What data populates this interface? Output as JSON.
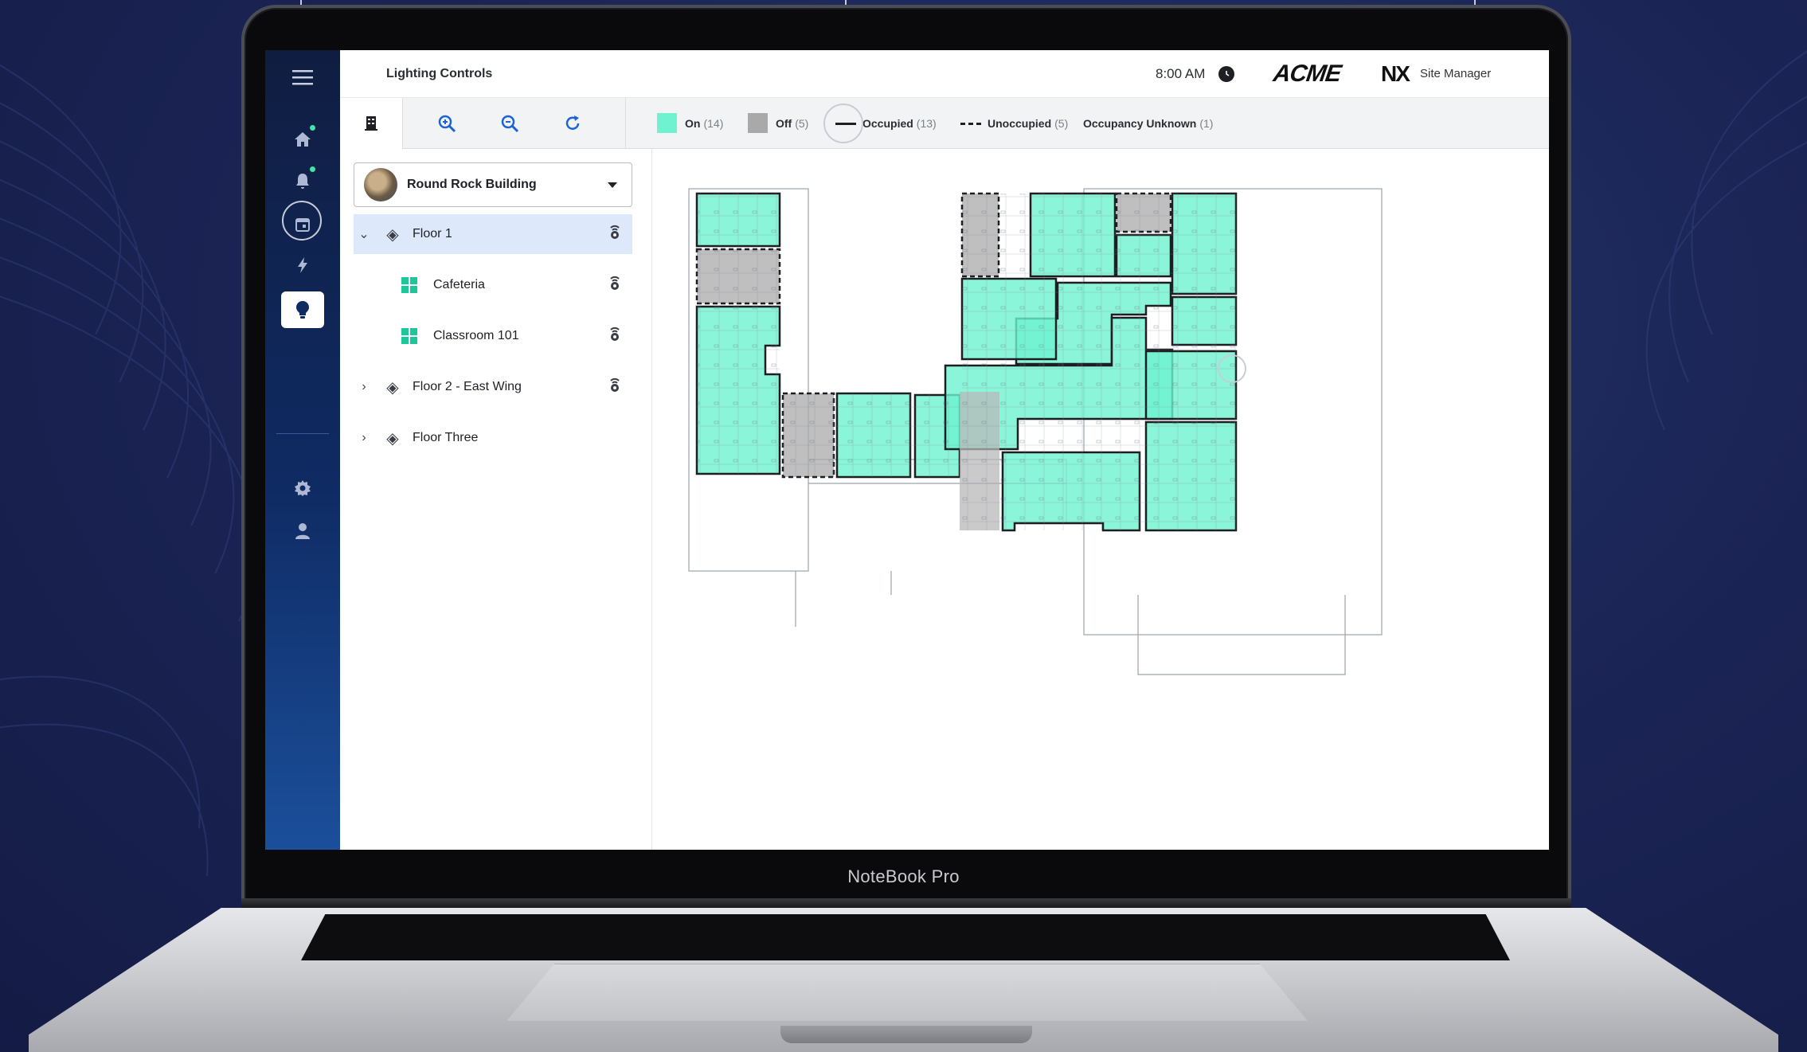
{
  "device": {
    "label": "NoteBook Pro"
  },
  "app": {
    "title": "Lighting Controls",
    "time": "8:00 AM",
    "brand": "ACME",
    "product_logo": "NX",
    "product_name": "Site Manager"
  },
  "rail": {
    "items": [
      {
        "icon": "menu-icon"
      },
      {
        "icon": "home-icon",
        "badge": true
      },
      {
        "icon": "bell-icon",
        "badge": true
      },
      {
        "icon": "calendar-icon"
      },
      {
        "icon": "bolt-icon"
      },
      {
        "icon": "lightbulb-icon",
        "active": true
      },
      {
        "icon": "gear-icon"
      },
      {
        "icon": "user-icon"
      }
    ]
  },
  "toolbar": {
    "tools": [
      "building-view-icon",
      "zoom-in-icon",
      "zoom-out-icon",
      "refresh-icon"
    ],
    "legend": {
      "on": {
        "label": "On",
        "count": "(14)",
        "color": "#6ef2cf"
      },
      "off": {
        "label": "Off",
        "count": "(5)",
        "color": "#a9a9a9"
      },
      "occupied": {
        "label": "Occupied",
        "count": "(13)"
      },
      "unoccupied": {
        "label": "Unoccupied",
        "count": "(5)"
      },
      "unknown": {
        "label": "Occupancy Unknown",
        "count": "(1)"
      }
    }
  },
  "sidebar": {
    "building": "Round Rock Building",
    "tree": [
      {
        "label": "Floor 1",
        "expanded": true,
        "selected": true
      },
      {
        "label": "Cafeteria"
      },
      {
        "label": "Classroom 101"
      },
      {
        "label": "Floor 2 - East Wing",
        "expanded": false
      },
      {
        "label": "Floor Three",
        "expanded": false
      }
    ]
  },
  "colors": {
    "on": "#6ef2cf",
    "off": "#a9a9a9",
    "accent": "#1b63d6",
    "rail": "#0f2b63"
  }
}
